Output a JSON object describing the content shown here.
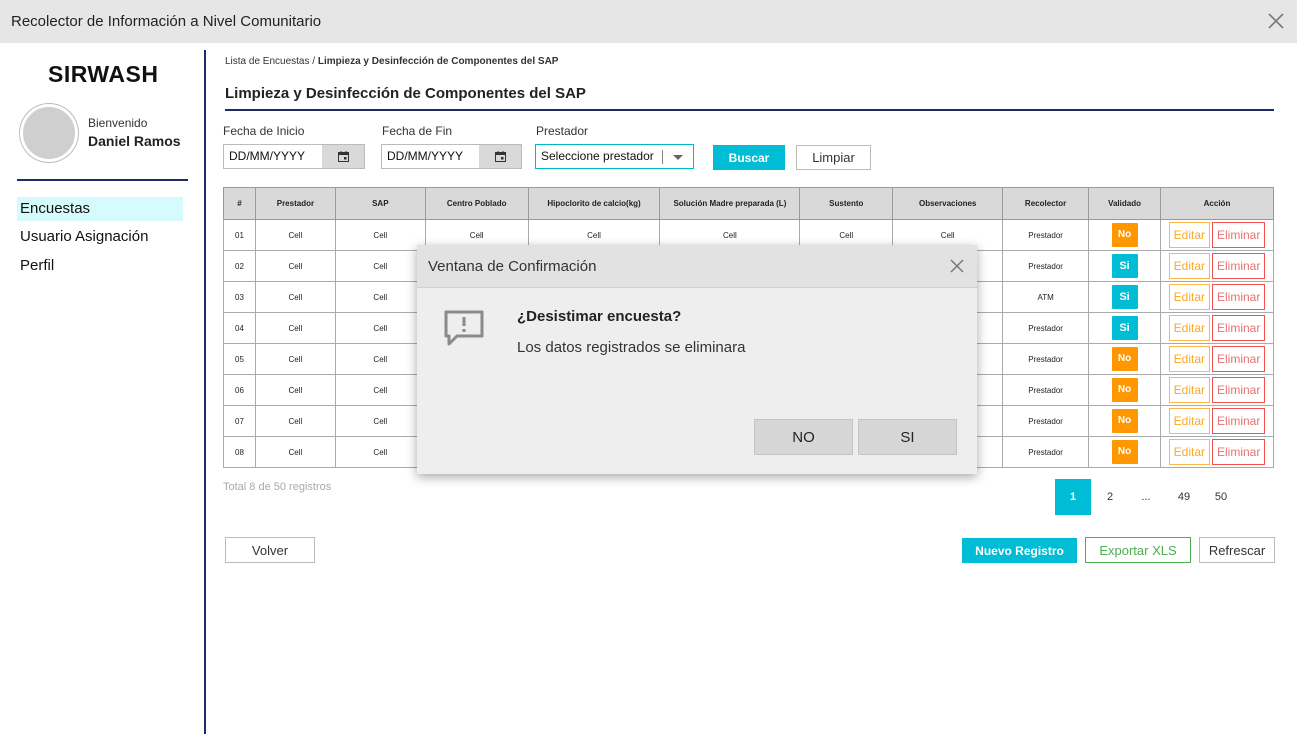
{
  "window": {
    "title": "Recolector de Información a Nivel Comunitario"
  },
  "sidebar": {
    "brand": "SIRWASH",
    "welcome": "Bienvenido",
    "user_name": "Daniel Ramos",
    "items": [
      {
        "label": "Encuestas",
        "active": true
      },
      {
        "label": "Usuario Asignación",
        "active": false
      },
      {
        "label": "Perfil",
        "active": false
      }
    ]
  },
  "breadcrumb": {
    "root": "Lista de Encuestas",
    "separator": "/",
    "current": "Limpieza y Desinfección de Componentes del SAP"
  },
  "page": {
    "title": "Limpieza y Desinfección de Componentes del SAP"
  },
  "filters": {
    "start_label": "Fecha de Inicio",
    "start_value": "DD/MM/YYYY",
    "end_label": "Fecha de Fin",
    "end_value": "DD/MM/YYYY",
    "provider_label": "Prestador",
    "provider_value": "Seleccione prestador",
    "search_button": "Buscar",
    "clear_button": "Limpiar"
  },
  "table": {
    "headers": [
      "#",
      "Prestador",
      "SAP",
      "Centro Poblado",
      "Hipoclorito de calcio(kg)",
      "Solución Madre preparada (L)",
      "Sustento",
      "Observaciones",
      "Recolector",
      "Validado",
      "Acción"
    ],
    "rows": [
      {
        "num": "01",
        "prestador": "Cell",
        "sap": "Cell",
        "centro": "Cell",
        "hipo": "Cell",
        "sol": "Cell",
        "sustento": "Cell",
        "obs": "Cell",
        "recolector": "Prestador",
        "validado": "No"
      },
      {
        "num": "02",
        "prestador": "Cell",
        "sap": "Cell",
        "centro": "",
        "hipo": "",
        "sol": "",
        "sustento": "",
        "obs": "",
        "recolector": "Prestador",
        "validado": "Si"
      },
      {
        "num": "03",
        "prestador": "Cell",
        "sap": "Cell",
        "centro": "",
        "hipo": "",
        "sol": "",
        "sustento": "",
        "obs": "",
        "recolector": "ATM",
        "validado": "Si"
      },
      {
        "num": "04",
        "prestador": "Cell",
        "sap": "Cell",
        "centro": "",
        "hipo": "",
        "sol": "",
        "sustento": "",
        "obs": "",
        "recolector": "Prestador",
        "validado": "Si"
      },
      {
        "num": "05",
        "prestador": "Cell",
        "sap": "Cell",
        "centro": "",
        "hipo": "",
        "sol": "",
        "sustento": "",
        "obs": "",
        "recolector": "Prestador",
        "validado": "No"
      },
      {
        "num": "06",
        "prestador": "Cell",
        "sap": "Cell",
        "centro": "",
        "hipo": "",
        "sol": "",
        "sustento": "",
        "obs": "",
        "recolector": "Prestador",
        "validado": "No"
      },
      {
        "num": "07",
        "prestador": "Cell",
        "sap": "Cell",
        "centro": "",
        "hipo": "",
        "sol": "",
        "sustento": "",
        "obs": "",
        "recolector": "Prestador",
        "validado": "No"
      },
      {
        "num": "08",
        "prestador": "Cell",
        "sap": "Cell",
        "centro": "",
        "hipo": "",
        "sol": "",
        "sustento": "",
        "obs": "",
        "recolector": "Prestador",
        "validado": "No"
      }
    ],
    "edit_label": "Editar",
    "delete_label": "Eliminar",
    "colors": {
      "no": "#ff9800",
      "si": "#00bcd4"
    }
  },
  "footer": {
    "total_text": "Total 8 de 50 registros",
    "pages": [
      "1",
      "2",
      "...",
      "49",
      "50"
    ],
    "active_page": "1",
    "back_button": "Volver",
    "new_button": "Nuevo Registro",
    "export_button": "Exportar XLS",
    "refresh_button": "Refrescar"
  },
  "modal": {
    "title": "Ventana de Confirmación",
    "question": "¿Desistimar encuesta?",
    "message": "Los datos registrados se eliminara",
    "no_button": "NO",
    "yes_button": "SI",
    "icon": "message-alert-icon"
  },
  "colors": {
    "accent": "#00bcd4",
    "navy": "#1f2a6b",
    "export_green": "#4caf50"
  }
}
